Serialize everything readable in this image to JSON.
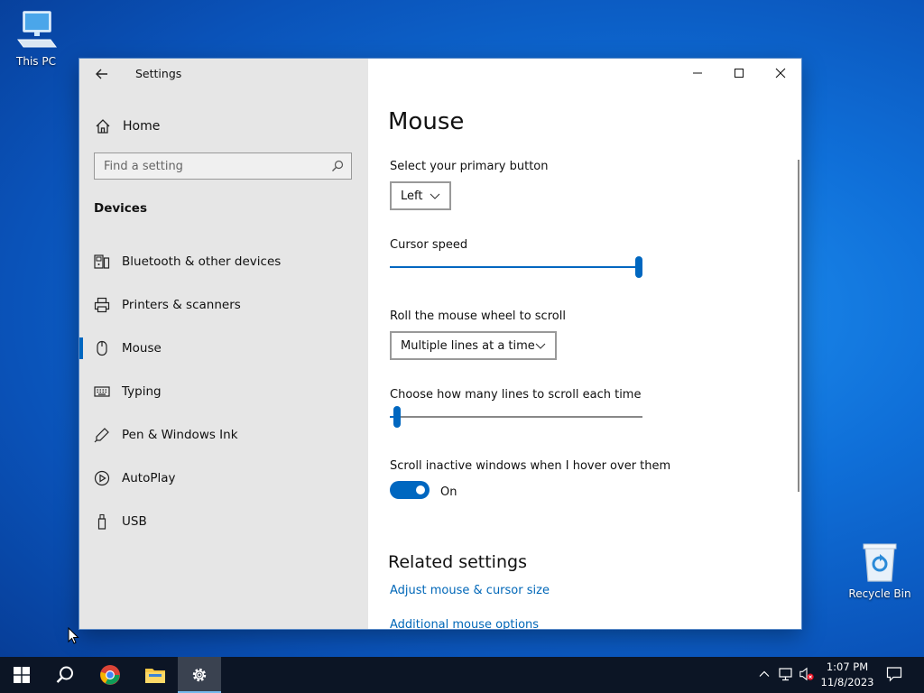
{
  "desktop": {
    "this_pc_label": "This PC",
    "recycle_bin_label": "Recycle Bin"
  },
  "window": {
    "title": "Settings",
    "sidebar": {
      "home_label": "Home",
      "search_placeholder": "Find a setting",
      "section_title": "Devices",
      "items": [
        {
          "label": "Bluetooth & other devices",
          "icon": "bluetooth-devices-icon"
        },
        {
          "label": "Printers & scanners",
          "icon": "printer-icon"
        },
        {
          "label": "Mouse",
          "icon": "mouse-icon",
          "active": true
        },
        {
          "label": "Typing",
          "icon": "keyboard-icon"
        },
        {
          "label": "Pen & Windows Ink",
          "icon": "pen-icon"
        },
        {
          "label": "AutoPlay",
          "icon": "autoplay-icon"
        },
        {
          "label": "USB",
          "icon": "usb-icon"
        }
      ]
    },
    "content": {
      "title": "Mouse",
      "primary_button_label": "Select your primary button",
      "primary_button_value": "Left",
      "cursor_speed_label": "Cursor speed",
      "cursor_speed_fraction": 1.0,
      "scroll_label": "Roll the mouse wheel to scroll",
      "scroll_value": "Multiple lines at a time",
      "lines_label": "Choose how many lines to scroll each time",
      "lines_fraction": 0.03,
      "inactive_label": "Scroll inactive windows when I hover over them",
      "inactive_state": "On",
      "related_title": "Related settings",
      "link_adjust": "Adjust mouse & cursor size",
      "link_additional": "Additional mouse options"
    }
  },
  "taskbar": {
    "time": "1:07 PM",
    "date": "11/8/2023"
  },
  "colors": {
    "accent": "#0067c0",
    "link": "#0067b8",
    "taskbar": "#0c1525"
  }
}
